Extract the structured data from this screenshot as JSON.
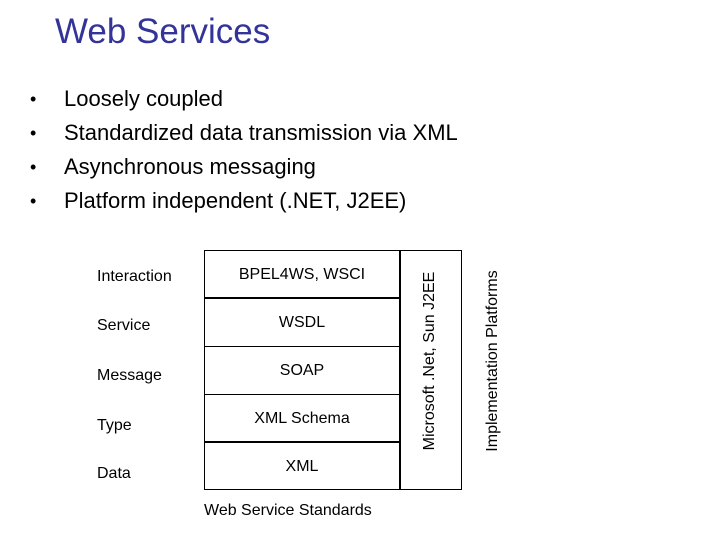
{
  "title": "Web Services",
  "bullets": [
    "Loosely coupled",
    "Standardized data transmission via XML",
    "Asynchronous messaging",
    "Platform independent (.NET, J2EE)"
  ],
  "bullet_glyph": "•",
  "diagram": {
    "layers": [
      {
        "label": "Interaction",
        "standard": "BPEL4WS, WSCI"
      },
      {
        "label": "Service",
        "standard": "WSDL"
      },
      {
        "label": "Message",
        "standard": "SOAP"
      },
      {
        "label": "Type",
        "standard": "XML Schema"
      },
      {
        "label": "Data",
        "standard": "XML"
      }
    ],
    "stack_caption": "Web Service Standards",
    "platform_box_text": "Microsoft .Net, Sun J2EE",
    "platform_caption": "Implementation Platforms"
  }
}
